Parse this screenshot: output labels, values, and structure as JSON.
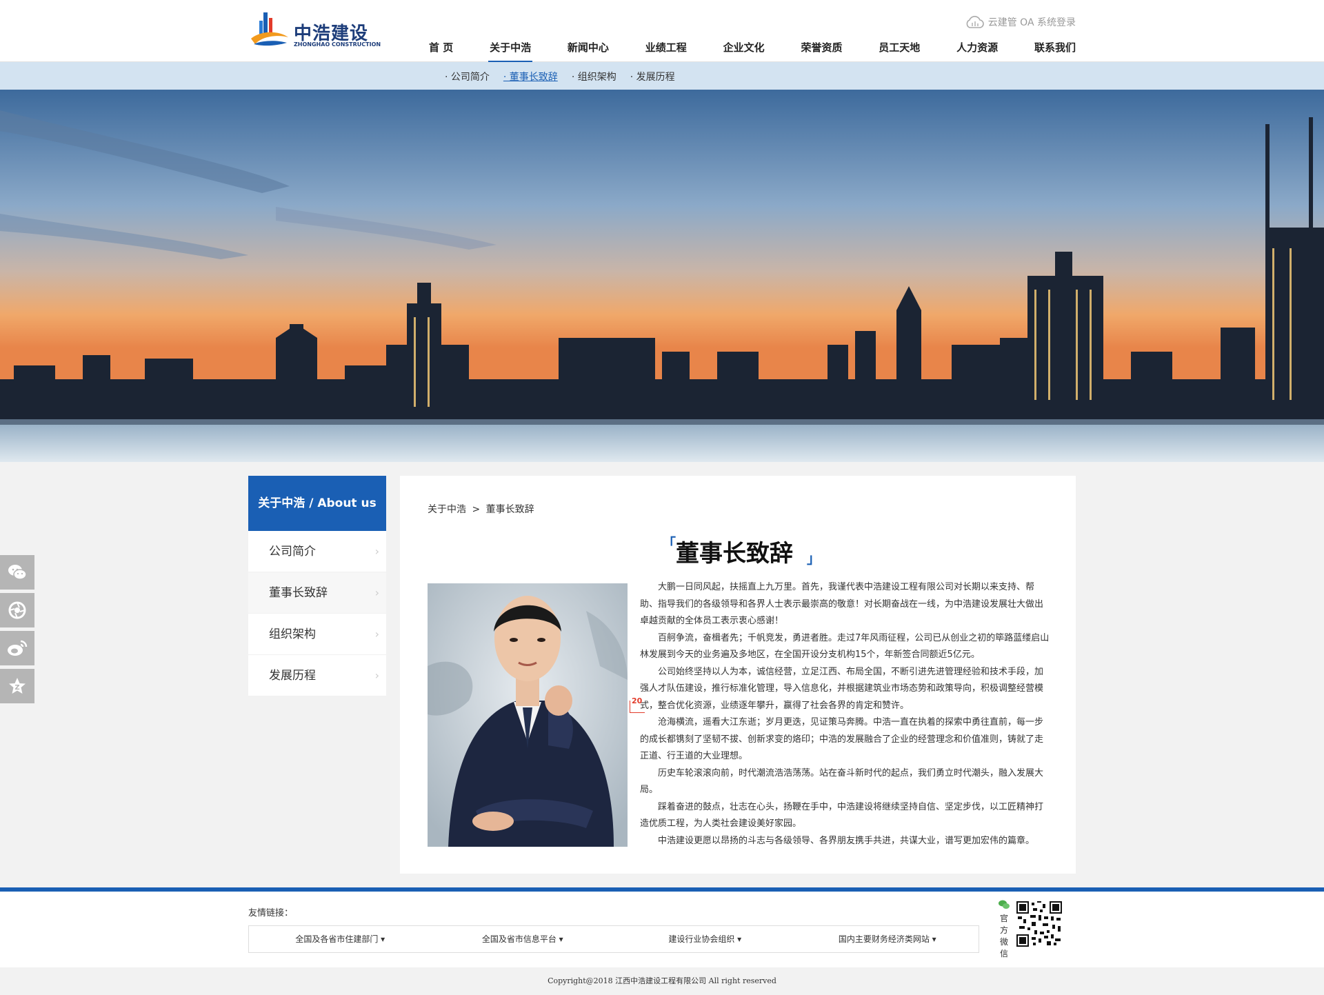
{
  "header": {
    "logo_title": "中浩建设",
    "logo_subtitle": "ZHONGHAO CONSTRUCTION",
    "oa_label": "云建管 OA 系统登录",
    "nav": [
      "首 页",
      "关于中浩",
      "新闻中心",
      "业绩工程",
      "企业文化",
      "荣誉资质",
      "员工天地",
      "人力资源",
      "联系我们"
    ],
    "nav_active": "关于中浩"
  },
  "subnav": {
    "items": [
      "· 公司简介",
      "· 董事长致辞",
      "· 组织架构",
      "· 发展历程"
    ],
    "active": "· 董事长致辞"
  },
  "sidebar": {
    "title": "关于中浩 / About us",
    "items": [
      "公司简介",
      "董事长致辞",
      "组织架构",
      "发展历程"
    ],
    "active": "董事长致辞"
  },
  "breadcrumb": {
    "parent": "关于中浩",
    "separator": ">",
    "current": "董事长致辞"
  },
  "article": {
    "title": "董事长致辞",
    "paragraphs": [
      "大鹏一日同风起，扶摇直上九万里。首先，我谨代表中浩建设工程有限公司对长期以来支持、帮助、指导我们的各级领导和各界人士表示最崇高的敬意！对长期奋战在一线，为中浩建设发展壮大做出卓越贡献的全体员工表示衷心感谢！",
      "百舸争流，奋楫者先；千帆竞发，勇进者胜。走过7年风雨征程，公司已从创业之初的筚路蓝缕启山林发展到今天的业务遍及多地区，在全国开设分支机构15个，年新签合同额近5亿元。",
      "公司始终坚持以人为本，诚信经营，立足江西、布局全国，不断引进先进管理经验和技术手段，加强人才队伍建设，推行标准化管理，导入信息化，并根据建筑业市场态势和政策导向，积极调整经营模式，整合优化资源，业绩逐年攀升，赢得了社会各界的肯定和赞许。",
      "沧海横流，遥看大江东逝；岁月更迭，见证策马奔腾。中浩一直在执着的探索中勇往直前，每一步的成长都镌刻了坚韧不拔、创新求变的烙印；中浩的发展融合了企业的经营理念和价值准则，铸就了走正道、行王道的大业理想。",
      "历史车轮滚滚向前，时代潮流浩浩荡荡。站在奋斗新时代的起点，我们勇立时代潮头，融入发展大局。",
      "踩着奋进的鼓点，壮志在心头，扬鞭在手中，中浩建设将继续坚持自信、坚定步伐，以工匠精神打造优质工程，为人类社会建设美好家园。",
      "中浩建设更愿以昂扬的斗志与各级领导、各界朋友携手共进，共谋大业，谱写更加宏伟的篇章。"
    ],
    "overlay_tag": "20"
  },
  "social": [
    "wechat-icon",
    "camera-shutter-icon",
    "weibo-icon",
    "star-badge-icon"
  ],
  "footer": {
    "links_label": "友情链接：",
    "link_groups": [
      "全国及各省市住建部门",
      "全国及省市信息平台",
      "建设行业协会组织",
      "国内主要财务经济类网站"
    ],
    "wechat_label": "官方微信",
    "copyright": "Copyright@2018 江西中浩建设工程有限公司 All right reserved"
  },
  "colors": {
    "brand_blue": "#1a5fb4",
    "subnav_bg": "#d3e3f1",
    "page_bg": "#f2f2f2"
  }
}
